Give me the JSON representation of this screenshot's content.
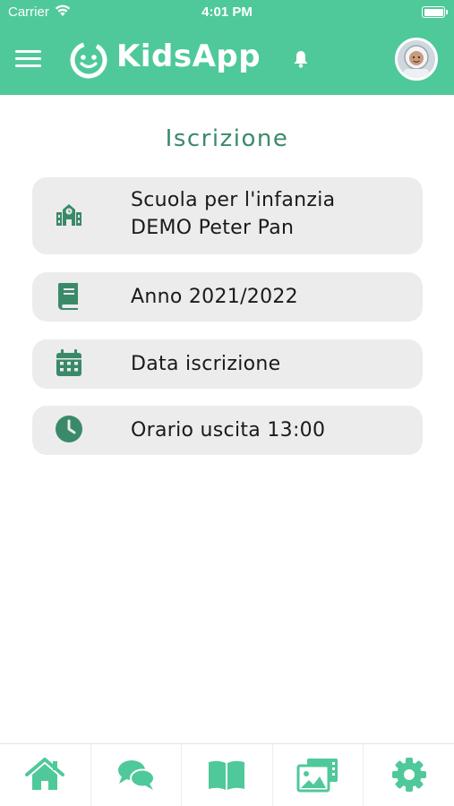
{
  "status_bar": {
    "carrier": "Carrier",
    "time": "4:01 PM"
  },
  "header": {
    "app_name": "KidsApp",
    "menu_icon": "hamburger-menu-icon",
    "logo_icon": "smiley-face-icon",
    "notification_icon": "bell-icon",
    "brand_color": "#4fc99a"
  },
  "page": {
    "title": "Iscrizione",
    "title_color": "#3a8a6a"
  },
  "cards": {
    "school": {
      "line1": "Scuola per l'infanzia",
      "line2": "DEMO Peter Pan",
      "icon": "school-icon"
    },
    "year": {
      "label": "Anno 2021/2022",
      "icon": "book-icon"
    },
    "date": {
      "label": "Data iscrizione",
      "icon": "calendar-icon"
    },
    "exit_time": {
      "label": "Orario uscita 13:00",
      "icon": "clock-icon"
    }
  },
  "bottom_nav": {
    "items": [
      {
        "icon": "home-icon"
      },
      {
        "icon": "chat-icon"
      },
      {
        "icon": "book-open-icon"
      },
      {
        "icon": "gallery-icon"
      },
      {
        "icon": "gear-icon"
      }
    ]
  }
}
